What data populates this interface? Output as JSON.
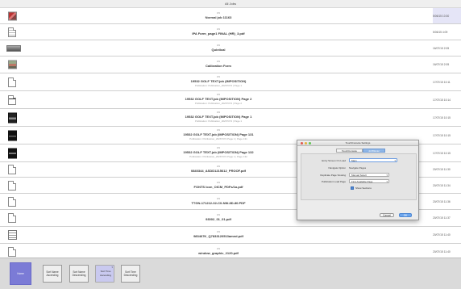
{
  "header": {
    "title": "All Jobs"
  },
  "jobs": [
    {
      "id": "209",
      "name": "Normal job 11163",
      "sub": "",
      "time": "5/06/15 10:30",
      "thumb": "image-thumbnail-red",
      "accent": true
    },
    {
      "id": "209",
      "name": "IPA Form_page1 FINAL (HR)_3.pdf",
      "sub": "",
      "time": "5/06/15 4:09",
      "thumb": "document-thumbnail",
      "accent": false
    },
    {
      "id": "209",
      "name": "Quixtical",
      "sub": "",
      "time": "16/07/15 2:05",
      "thumb": "wide-image-thumbnail",
      "accent": false
    },
    {
      "id": "209",
      "name": "Calibration Form",
      "sub": "",
      "time": "16/07/15 2:05",
      "thumb": "image-thumbnail-photo",
      "accent": false
    },
    {
      "id": "209",
      "name": "19532 GOLF TEXT.job (IMPOSITION)",
      "sub": "Publication: Publication_20267374 | Page 1",
      "time": "17/07/15 10:11",
      "thumb": "blank-page-thumbnail",
      "accent": false
    },
    {
      "id": "209",
      "name": "19532 GOLF TEXT.job (IMPOSITION) Page 2",
      "sub": "Publication: Publication_20267374 | Page 2",
      "time": "17/07/15 10:14",
      "thumb": "page-thumbnail",
      "accent": false
    },
    {
      "id": "209",
      "name": "19532 GOLF TEXT.job (IMPOSITION) Page 1",
      "sub": "Publication: Publication_20267374 | Page 1",
      "time": "17/07/15 10:15",
      "thumb": "dark-page-thumbnail",
      "accent": false
    },
    {
      "id": "209",
      "name": "19532 GOLF TEXT.job (IMPOSITION) Page 131",
      "sub": "Publication: Publication_20267374 Page 1 | Page 131",
      "time": "17/07/15 10:15",
      "thumb": "dark-page-thumbnail",
      "accent": false
    },
    {
      "id": "209",
      "name": "19532 GOLF TEXT.job (IMPOSITION) Page 132",
      "sub": "Publication: Publication_20267374 Page 1 | Page 132",
      "time": "17/07/15 10:15",
      "thumb": "dark-page-thumbnail",
      "accent": false
    },
    {
      "id": "209",
      "name": "0840344_ASDD1215612_PROOF.pdf",
      "sub": "",
      "time": "20/07/15 11:30",
      "thumb": "blank-page-thumbnail",
      "accent": false
    },
    {
      "id": "209",
      "name": "FONTS Icon_OICM_PDFs/1a.pdf",
      "sub": "",
      "time": "20/07/15 11:34",
      "thumb": "blank-page-thumbnail",
      "accent": false
    },
    {
      "id": "209",
      "name": "TTGN-171212-02-C0-NW-8D-80.PDF",
      "sub": "",
      "time": "20/07/15 11:36",
      "thumb": "blank-page-thumbnail",
      "accent": false
    },
    {
      "id": "209",
      "name": "93002_01_01.pdf",
      "sub": "",
      "time": "20/07/15 11:37",
      "thumb": "blank-page-thumbnail",
      "accent": false
    },
    {
      "id": "209",
      "name": "983467K_Q7833120513amnd.pdf",
      "sub": "",
      "time": "20/07/15 11:40",
      "thumb": "pdf-document-thumbnail",
      "accent": false
    },
    {
      "id": "209",
      "name": "window_graphic_2120.pdf",
      "sub": "",
      "time": "20/07/15 11:40",
      "thumb": "blank-page-thumbnail",
      "accent": false
    }
  ],
  "footer": {
    "home": "Home",
    "sort_name_asc": "Sort Name Ascending",
    "sort_name_desc": "Sort Name Descending",
    "sort_time_asc": "Sort Time Ascending",
    "sort_time_desc": "Sort Time Descending"
  },
  "dialog": {
    "title": "TouchConsole Settings",
    "tabs": [
      "TouchConsole",
      "JobBlaster"
    ],
    "active_tab": "JobBlaster",
    "entry_screen_label": "Entry Screen On Load",
    "entry_screen_value": "Main",
    "navigate_option_label": "Navigate Option",
    "navigate_option_value": "Navigate Pages",
    "duplicate_page_label": "Duplicate Page Viewing",
    "duplicate_page_value": "Manual Select",
    "publication_load_label": "Publication Load Page",
    "publication_load_value": "First Available Page",
    "show_sections_label": "Show Sections",
    "cancel_label": "Cancel",
    "ok_label": "OK"
  },
  "colors": {
    "accent": "#7b7bd6",
    "accent_light": "#c9c9ef",
    "dialog_ok": "#6ea7ee"
  }
}
